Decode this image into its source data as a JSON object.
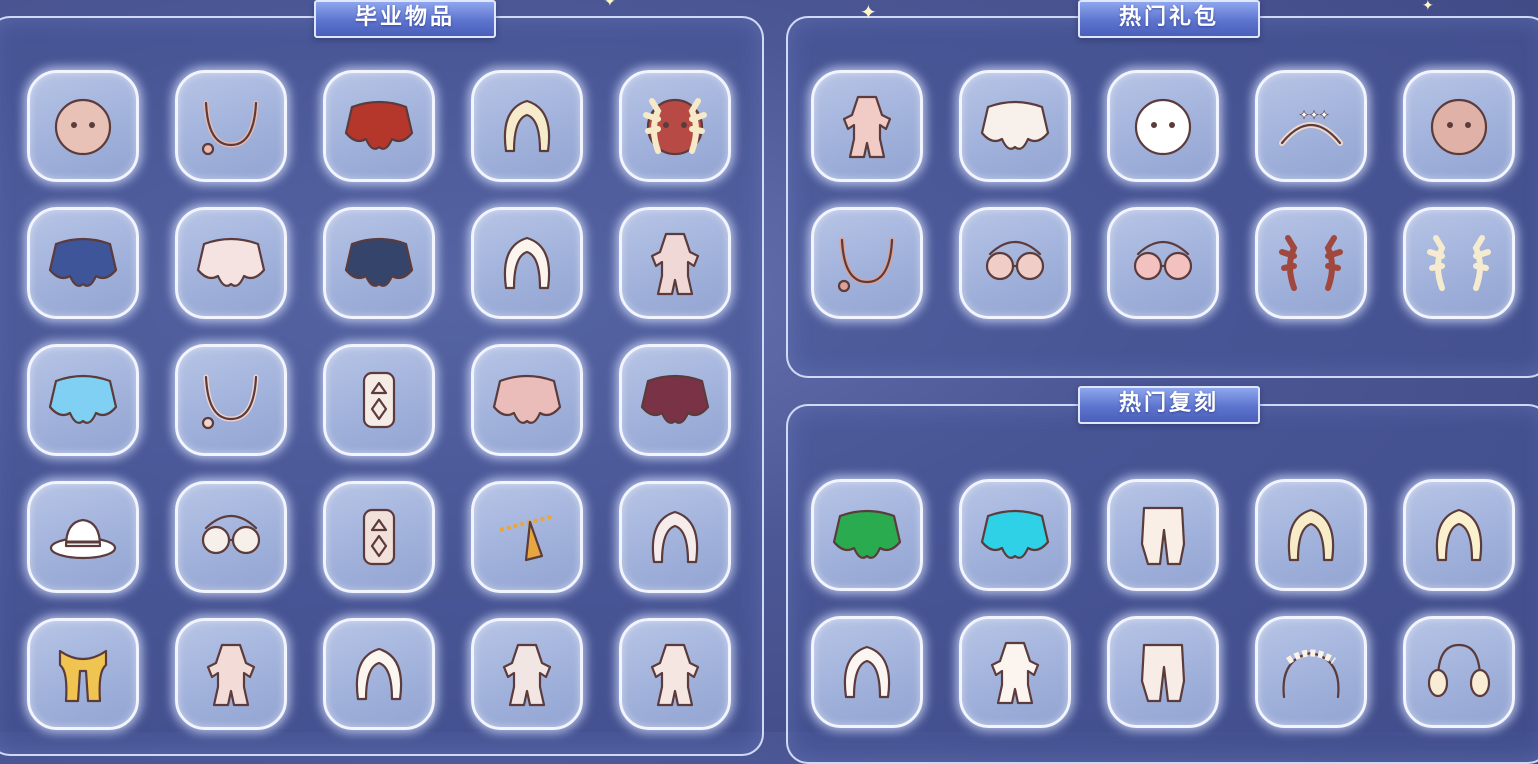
{
  "sections": {
    "graduation": {
      "title": "毕业物品"
    },
    "hot_gifts": {
      "title": "热门礼包"
    },
    "hot_reprint": {
      "title": "热门复刻"
    }
  },
  "colors": {
    "panel_border": "#e1e8ff",
    "banner_top": "#8ea6ee",
    "banner_bottom": "#4a5fb9",
    "slot_bg": "#a9b8df",
    "background": "#4c5896"
  },
  "graduation_items": [
    "round-hat-icon",
    "hair-strand-icon",
    "red-cape-icon",
    "pigtail-hair-icon",
    "antler-mask-icon",
    "blue-cape-icon",
    "white-wing-cape-icon",
    "dark-armor-cape-icon",
    "long-hair-icon",
    "robe-outfit-icon",
    "blue-wing-cape-icon",
    "ribbon-scarf-icon",
    "amulet-prop-icon",
    "shell-cape-icon",
    "maroon-cape-icon",
    "cowboy-hat-icon",
    "glasses-icon",
    "banner-prop-icon",
    "golden-chain-icon",
    "feather-hair-icon",
    "golden-scarf-icon",
    "long-robe-icon",
    "bun-hair-icon",
    "constellation-prop-icon",
    "armor-outfit-icon"
  ],
  "gift_items": [
    "pink-outfit-icon",
    "fluffy-cape-icon",
    "white-mask-icon",
    "star-headband-icon",
    "pink-mask-icon",
    "braid-hair-icon",
    "round-glasses-icon",
    "heart-glasses-icon",
    "red-antlers-icon",
    "white-antlers-icon"
  ],
  "reprint_items": [
    "green-cape-icon",
    "cyan-cape-icon",
    "white-pants-icon",
    "wavy-hair-icon",
    "short-hair-icon",
    "cat-hood-icon",
    "white-outfit-icon",
    "cargo-pants-icon",
    "flower-crown-icon",
    "earmuffs-icon"
  ]
}
